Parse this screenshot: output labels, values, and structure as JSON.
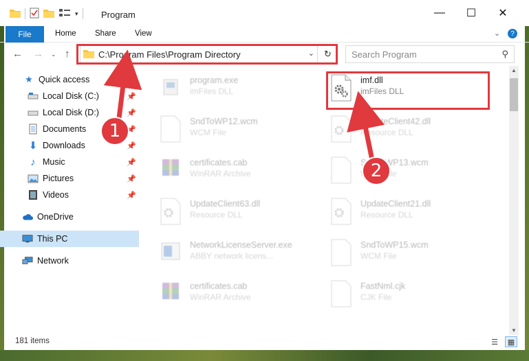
{
  "window": {
    "title": "Program",
    "buttons": {
      "minimize": "—",
      "maximize": "☐",
      "close": "✕"
    }
  },
  "ribbon": {
    "tabs": [
      "File",
      "Home",
      "Share",
      "View"
    ]
  },
  "address_bar": {
    "path": "C:\\Program Files\\Program Directory"
  },
  "search": {
    "placeholder": "Search Program"
  },
  "sidebar": {
    "items": [
      {
        "label": "Quick access",
        "icon": "star-icon",
        "pinned": false
      },
      {
        "label": "Local Disk (C:)",
        "icon": "drive-icon",
        "pinned": true
      },
      {
        "label": "Local Disk (D:)",
        "icon": "drive-icon",
        "pinned": true
      },
      {
        "label": "Documents",
        "icon": "documents-icon",
        "pinned": true
      },
      {
        "label": "Downloads",
        "icon": "downloads-icon",
        "pinned": true
      },
      {
        "label": "Music",
        "icon": "music-icon",
        "pinned": true
      },
      {
        "label": "Pictures",
        "icon": "pictures-icon",
        "pinned": true
      },
      {
        "label": "Videos",
        "icon": "videos-icon",
        "pinned": true
      },
      {
        "label": "OneDrive",
        "icon": "onedrive-icon",
        "pinned": false
      },
      {
        "label": "This PC",
        "icon": "pc-icon",
        "pinned": false
      },
      {
        "label": "Network",
        "icon": "network-icon",
        "pinned": false
      }
    ]
  },
  "files": [
    {
      "name": "program.exe",
      "type": "imFiles DLL",
      "icon": "exe-icon",
      "highlighted": false
    },
    {
      "name": "imf.dll",
      "type": "imFiles DLL",
      "icon": "dll-gear-icon",
      "highlighted": true
    },
    {
      "name": "SndToWP12.wcm",
      "type": "WCM File",
      "icon": "blank-file-icon",
      "highlighted": false
    },
    {
      "name": "UpdateClient42.dll",
      "type": "Resource DLL",
      "icon": "dll-gear-icon",
      "highlighted": false
    },
    {
      "name": "certificates.cab",
      "type": "WinRAR Archive",
      "icon": "winrar-icon",
      "highlighted": false
    },
    {
      "name": "SndToWP13.wcm",
      "type": "WCM File",
      "icon": "blank-file-icon",
      "highlighted": false
    },
    {
      "name": "UpdateClient63.dll",
      "type": "Resource DLL",
      "icon": "dll-gear-icon",
      "highlighted": false
    },
    {
      "name": "UpdateClient21.dll",
      "type": "Resource DLL",
      "icon": "dll-gear-icon",
      "highlighted": false
    },
    {
      "name": "NetworkLicenseServer.exe",
      "type": "ABBY network licens...",
      "icon": "app-icon",
      "highlighted": false
    },
    {
      "name": "SndToWP15.wcm",
      "type": "WCM File",
      "icon": "blank-file-icon",
      "highlighted": false
    },
    {
      "name": "certificates.cab",
      "type": "WinRAR Archive",
      "icon": "winrar-icon",
      "highlighted": false
    },
    {
      "name": "FastNml.cjk",
      "type": "CJK File",
      "icon": "blank-file-icon",
      "highlighted": false
    }
  ],
  "annotations": {
    "step1": "1",
    "step2": "2"
  },
  "statusbar": {
    "count": "181 items"
  },
  "colors": {
    "accent": "#1979ca",
    "annotation": "#e0393e",
    "selection": "#cce4f7"
  }
}
